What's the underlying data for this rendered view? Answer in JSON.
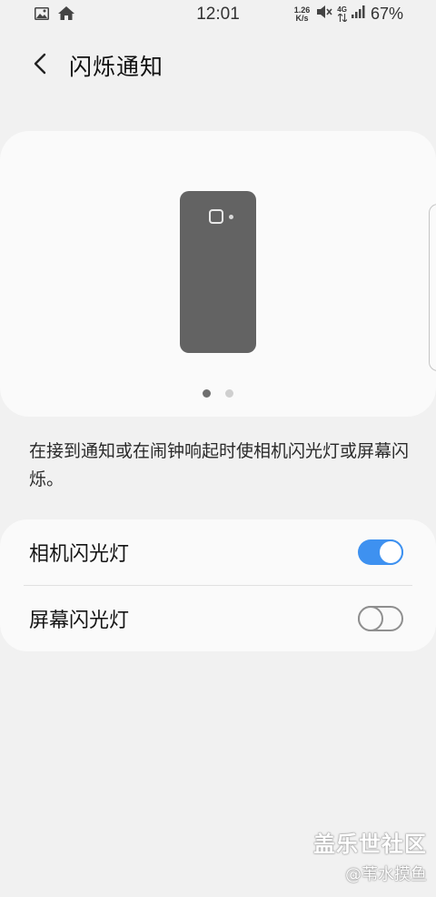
{
  "status_bar": {
    "time": "12:01",
    "net_speed_value": "1.26",
    "net_speed_unit": "K/s",
    "network_type": "4G",
    "battery": "67%",
    "left_icons": [
      "image-icon",
      "home-icon"
    ],
    "right_icons": [
      "mute-icon",
      "4g-data-icon",
      "signal-icon"
    ]
  },
  "header": {
    "title": "闪烁通知",
    "back_icon": "back-arrow-icon"
  },
  "preview": {
    "page_count": 2,
    "active_page": 1
  },
  "description": "在接到通知或在闹钟响起时使相机闪光灯或屏幕闪烁。",
  "settings": {
    "items": [
      {
        "label": "相机闪光灯",
        "enabled": true
      },
      {
        "label": "屏幕闪光灯",
        "enabled": false
      }
    ]
  },
  "watermark": {
    "brand": "盖乐世社区",
    "handle": "@苇水摸鱼"
  },
  "colors": {
    "accent": "#3e91f0",
    "background": "#f1f1f1",
    "card": "#fafafa",
    "phone_illustration": "#636363"
  }
}
